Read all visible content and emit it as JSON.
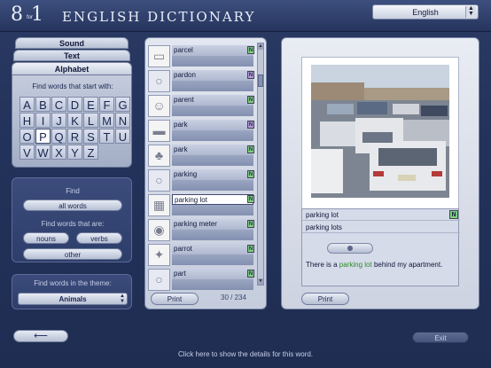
{
  "header": {
    "logo_number": "8 1",
    "logo_for": "for",
    "title": "ENGLISH DICTIONARY",
    "language": "English"
  },
  "left_panel": {
    "tabs": [
      {
        "label": "Sound"
      },
      {
        "label": "Text"
      },
      {
        "label": "Alphabet"
      }
    ],
    "alphabet_prompt": "Find words that start with:",
    "letters": [
      "A",
      "B",
      "C",
      "D",
      "E",
      "F",
      "G",
      "H",
      "I",
      "J",
      "K",
      "L",
      "M",
      "N",
      "O",
      "P",
      "Q",
      "R",
      "S",
      "T",
      "U",
      "V",
      "W",
      "X",
      "Y",
      "Z"
    ],
    "selected_letter": "P",
    "find_label": "Find",
    "all_words": "all words",
    "find_that_are": "Find words that are:",
    "nouns": "nouns",
    "verbs": "verbs",
    "other": "other",
    "theme_label": "Find words in the theme:",
    "theme_value": "Animals"
  },
  "word_list": {
    "items": [
      {
        "word": "parcel",
        "badge": "N",
        "badge_color": "#7fd07f",
        "thumb_icon": "box-icon",
        "selected": false
      },
      {
        "word": "pardon",
        "badge": "N",
        "badge_color": "#b49ad8",
        "thumb_icon": "placeholder-icon",
        "selected": false
      },
      {
        "word": "parent",
        "badge": "N",
        "badge_color": "#7fd07f",
        "thumb_icon": "family-icon",
        "selected": false
      },
      {
        "word": "park",
        "badge": "N",
        "badge_color": "#b49ad8",
        "thumb_icon": "car-icon",
        "selected": false
      },
      {
        "word": "park",
        "badge": "N",
        "badge_color": "#7fd07f",
        "thumb_icon": "park-icon",
        "selected": false
      },
      {
        "word": "parking",
        "badge": "N",
        "badge_color": "#7fd07f",
        "thumb_icon": "placeholder-icon",
        "selected": false
      },
      {
        "word": "parking lot",
        "badge": "N",
        "badge_color": "#7fd07f",
        "thumb_icon": "parking-lot-icon",
        "selected": true
      },
      {
        "word": "parking meter",
        "badge": "N",
        "badge_color": "#7fd07f",
        "thumb_icon": "meter-icon",
        "selected": false
      },
      {
        "word": "parrot",
        "badge": "N",
        "badge_color": "#7fd07f",
        "thumb_icon": "parrot-icon",
        "selected": false
      },
      {
        "word": "part",
        "badge": "N",
        "badge_color": "#7fd07f",
        "thumb_icon": "placeholder-icon",
        "selected": false
      }
    ],
    "print": "Print",
    "counter": "30 / 234"
  },
  "detail": {
    "word": "parking lot",
    "badge": "N",
    "plural": "parking lots",
    "sentence_before": "There is a ",
    "sentence_highlight": "parking lot",
    "sentence_after": " behind my apartment.",
    "print": "Print"
  },
  "footer": {
    "back_icon": "left-arrow-icon",
    "exit": "Exit",
    "status": "Click here to show the details for this word."
  }
}
